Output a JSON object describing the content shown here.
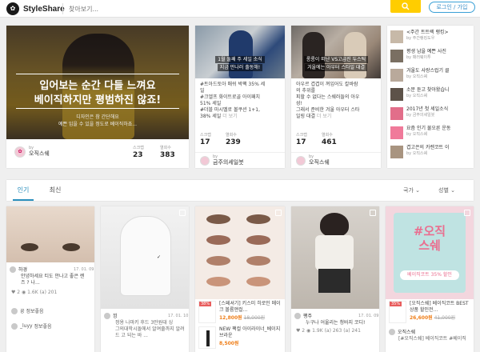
{
  "header": {
    "logo_text": "StyleShare",
    "search_placeholder": "찾아보기...",
    "login_label": "로그인 / 가입"
  },
  "featured": {
    "title_line1": "입어보는 순간 다들 느껴요",
    "title_line2": "베이직하지만 평범하진 않죠!",
    "subtitle_line1": "디자인은 참 간단해요",
    "subtitle_line2": "예쁜 입을 수 있을 정도로 베이직하죠...",
    "author_by": "by",
    "author": "오직스쉐",
    "scraps_label": "스크랩",
    "scraps": "23",
    "views_label": "열회수",
    "views": "383"
  },
  "mid_cards": [
    {
      "caption_line1": "1월 둘째 주 세일 소식",
      "caption_line2": "지금 만나러 출동해!",
      "body_line1": "#트아드토아 매쉬 박팩 35% 세",
      "body_line2": "일",
      "body_line3": "#크엘프 화이트로골 아이패치",
      "body_line4": "51% 세일",
      "body_line5": "#더블 마시멜로 볼쿠션 1+1,",
      "body_line6": "38% 세일",
      "more": "더 보기",
      "scraps_label": "스크랩",
      "scraps": "17",
      "views_label": "열회수",
      "views": "239",
      "author_by": "by",
      "author": "금주의세일붓"
    },
    {
      "caption_line1": "롱롱이 떠난 VS고급진 두스틱",
      "caption_line2": "겨울에는 아우터 스타일 대결",
      "body_line1": "아우르 겹겹이 껴입어도 칼바람",
      "body_line2": "의 추위를",
      "body_line3": "피할 수 없다는 스쉐러들의 아우",
      "body_line4": "성!",
      "body_line5": "그래서 준비한 겨울 아우터 스타",
      "body_line6": "일링 대결",
      "more": "더 보기",
      "scraps_label": "스크랩",
      "scraps": "17",
      "views_label": "열회수",
      "views": "461",
      "author_by": "by",
      "author": "오직스쉐"
    }
  ],
  "ranking": [
    {
      "title": "<주간 트트렉 랭킹>",
      "by": "by 주간랭킹도우"
    },
    {
      "title": "평생 남을 예쁜 사진",
      "by": "by 패러웨이투"
    },
    {
      "title": "겨울도 사랑스럽기 클",
      "by": "by 오직스쉐"
    },
    {
      "title": "소문 듣고 찾아왔습니",
      "by": "by 오직스쉐"
    },
    {
      "title": "2017년 첫 세일소식",
      "by": "by 금주의세일붓"
    },
    {
      "title": "요즘 인기 물오른 운동",
      "by": "by 오직스쉐"
    },
    {
      "title": "겹고은의 카렌코트 이",
      "by": "by 오직스쉐"
    }
  ],
  "tabs": {
    "popular": "인기",
    "recent": "최신",
    "country": "국가",
    "gender": "성별"
  },
  "feed": [
    {
      "name": "하경",
      "date": "17. 01. 09",
      "text1": "안녕하세요 티도 안나고 좋은 렌",
      "text2": "즈 ? 나...",
      "likes": "♥ 2 ",
      "comments": "◉ 1.6K",
      "shares": "(a) 201",
      "c1_name": "꿍",
      "c1_text": "정보좋음",
      "c2_name": "_luyy",
      "c2_text": "정보좋음"
    },
    {
      "name": "낑",
      "date": "17. 01. 10",
      "text1": "정용 나마키 후드 3만원대 싱",
      "text2": "그의대학시돌에서 알여줄까지 알려",
      "text3": "드 고 되는 바 ..."
    },
    {
      "product1_name": "[스페셔기] 키스미 히로인 메이크 볼륨앤컬...",
      "product1_sale": "38%",
      "product1_price": "12,800원",
      "product1_orig": "18,000원",
      "product2_name": "NEW 팩컬 아이라이너_베이지브라운",
      "product2_price": "8,500원"
    },
    {
      "name": "팽주",
      "date": "17. 01. 09",
      "text1": "누구나 어울리는 청바지 코디!",
      "likes": "♥ 2",
      "comments": "◉ 1.9K",
      "shares": "(a) 263",
      "extra": "(a) 241"
    },
    {
      "title1": "#오직",
      "title2": "스쉐",
      "promo": "베이직코트 35% 할인",
      "product_sale": "35%",
      "product_name": "[오직스쉐] 베이직코트 BEST 상품 할인전...",
      "product_price": "26,600원",
      "product_orig": "41,000원",
      "author": "오직스쉐",
      "author_text": "[#오직스쉐] 베이직코트 #베이직"
    }
  ],
  "colors": {
    "accent": "#2a8fbd",
    "search_button": "#ffcd00",
    "sale_red": "#e85d5d",
    "price_orange": "#ef7f1a"
  }
}
